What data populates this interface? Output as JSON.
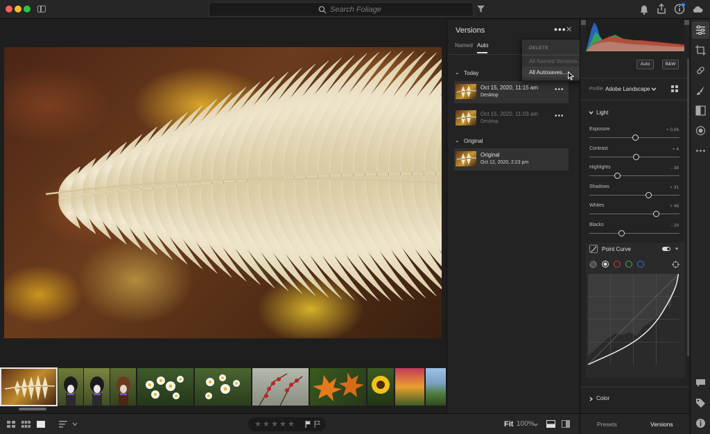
{
  "search": {
    "placeholder": "Search Foliage"
  },
  "versions_panel": {
    "title": "Versions",
    "tabs": [
      {
        "label": "Named"
      },
      {
        "label": "Auto"
      }
    ],
    "active_tab": "Auto",
    "sections": [
      {
        "title": "Today",
        "items": [
          {
            "date": "Oct 15, 2020, 11:15 am",
            "device": "Desktop",
            "selected": true
          },
          {
            "date": "Oct 15, 2020, 11:03 am",
            "device": "Desktop",
            "selected": false
          }
        ]
      },
      {
        "title": "Original",
        "items": [
          {
            "date": "Original",
            "device": "Oct 12, 2020, 2:23 pm",
            "selected": false
          }
        ]
      }
    ]
  },
  "menu": {
    "header": "DELETE",
    "items": [
      {
        "label": "All Named Versions...",
        "enabled": false
      },
      {
        "label": "All Autosaves...",
        "enabled": true
      }
    ]
  },
  "edit_panel": {
    "auto_label": "Auto",
    "bw_label": "B&W",
    "profile_label": "Profile",
    "profile_value": "Adobe Landscape",
    "light_title": "Light",
    "sliders": [
      {
        "label": "Exposure",
        "value": "+ 0.06",
        "level": 0.51
      },
      {
        "label": "Contrast",
        "value": "+ 4",
        "level": 0.52
      },
      {
        "label": "Highlights",
        "value": "- 38",
        "level": 0.31
      },
      {
        "label": "Shadows",
        "value": "+ 31",
        "level": 0.655
      },
      {
        "label": "Whites",
        "value": "+ 48",
        "level": 0.74
      },
      {
        "label": "Blacks",
        "value": "- 29",
        "level": 0.355
      }
    ],
    "point_curve_title": "Point Curve",
    "color_title": "Color"
  },
  "bottom_bar": {
    "fit_label": "Fit",
    "zoom_label": "100%",
    "stars": 5
  },
  "bottom_tabs": [
    {
      "label": "Presets",
      "active": false
    },
    {
      "label": "Versions",
      "active": true
    }
  ],
  "colors": {
    "background": "#1e1e1e",
    "panel": "#232323",
    "accent_red": "#fe5f57",
    "accent_yellow": "#febc2e",
    "accent_green": "#28c840",
    "notify_blue": "#2d8ceb"
  },
  "filmstrip": {
    "thumbs": [
      {
        "name": "fern",
        "selected": true
      },
      {
        "name": "dog-1"
      },
      {
        "name": "dog-2"
      },
      {
        "name": "dog-3"
      },
      {
        "name": "daisies-1"
      },
      {
        "name": "daisies-2"
      },
      {
        "name": "red-berries"
      },
      {
        "name": "orange-leaves"
      },
      {
        "name": "sunflower"
      },
      {
        "name": "autumn-tree"
      },
      {
        "name": "landscape"
      }
    ]
  }
}
